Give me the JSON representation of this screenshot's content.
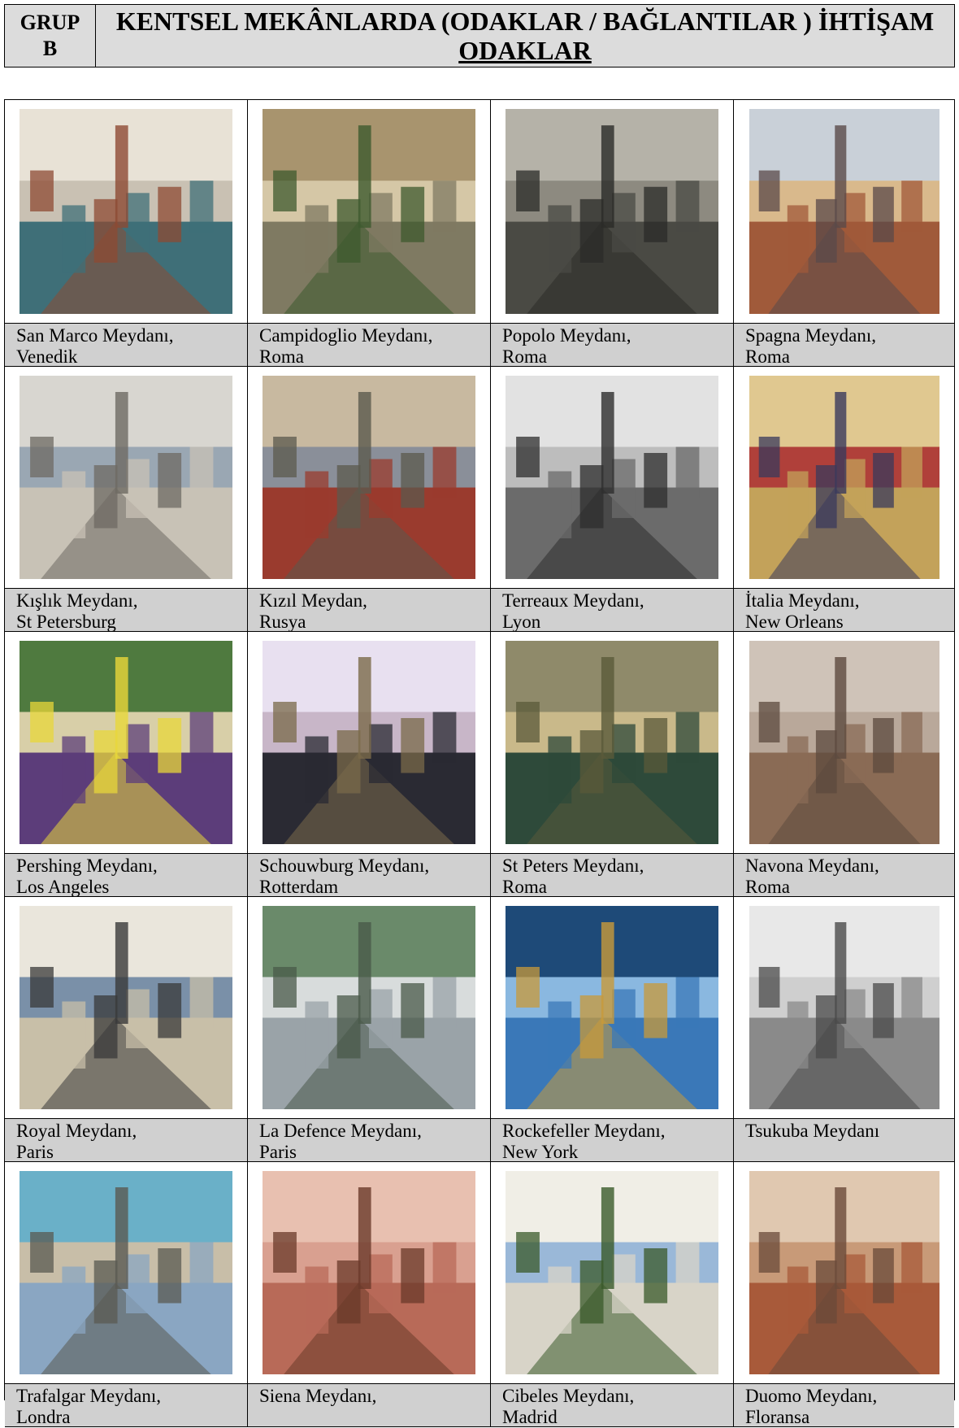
{
  "header": {
    "grup_label": "GRUP",
    "grup_value": "B",
    "title": "KENTSEL MEKÂNLARDA (ODAKLAR / BAĞLANTILAR ) İHTİŞAM",
    "subtitle": "ODAKLAR"
  },
  "cells": [
    {
      "line1": "San Marco Meydanı,",
      "line2": "Venedik",
      "palette": [
        "#3f6f78",
        "#c9c1b3",
        "#8d4a33",
        "#e8e2d6"
      ]
    },
    {
      "line1": "Campidoglio Meydanı,",
      "line2": "Roma",
      "palette": [
        "#7f7a62",
        "#d5c7a6",
        "#3d5a2e",
        "#a8946e"
      ]
    },
    {
      "line1": "Popolo Meydanı,",
      "line2": "Roma",
      "palette": [
        "#4a4a44",
        "#8d8a80",
        "#2b2b28",
        "#b5b2a8"
      ]
    },
    {
      "line1": "Spagna Meydanı,",
      "line2": "Roma",
      "palette": [
        "#a05a3a",
        "#d9b98c",
        "#5a4a4a",
        "#c9d0d8"
      ]
    },
    {
      "line1": "Kışlık Meydanı,",
      "line2": "St Petersburg",
      "palette": [
        "#c8c2b6",
        "#9aa7b3",
        "#6e6a63",
        "#d8d6d0"
      ]
    },
    {
      "line1": "Kızıl Meydan,",
      "line2": "Rusya",
      "palette": [
        "#9a3b2e",
        "#8a8f99",
        "#5b5a4e",
        "#c8b9a0"
      ]
    },
    {
      "line1": "Terreaux Meydanı,",
      "line2": "Lyon",
      "palette": [
        "#6b6b6b",
        "#bdbdbd",
        "#2e2e2e",
        "#e2e2e2"
      ]
    },
    {
      "line1": "İtalia Meydanı,",
      "line2": "New Orleans",
      "palette": [
        "#c3a25a",
        "#b0403a",
        "#3a3a5c",
        "#e0c890"
      ]
    },
    {
      "line1": "Pershing Meydanı,",
      "line2": "Los Angeles",
      "palette": [
        "#5c3d7a",
        "#d8cfa8",
        "#e8d73a",
        "#4f7a3f"
      ]
    },
    {
      "line1": "Schouwburg Meydanı,",
      "line2": "Rotterdam",
      "palette": [
        "#2a2a33",
        "#c8b6c8",
        "#7a6a4a",
        "#e8e0f0"
      ]
    },
    {
      "line1": "St Peters Meydanı,",
      "line2": "Roma",
      "palette": [
        "#2e4a3a",
        "#c9b98a",
        "#5a5a3a",
        "#8f8a6a"
      ]
    },
    {
      "line1": "Navona Meydanı,",
      "line2": "Roma",
      "palette": [
        "#8a6b55",
        "#b9a89a",
        "#5c4a3e",
        "#cfc3b8"
      ]
    },
    {
      "line1": "Royal Meydanı,",
      "line2": "Paris",
      "palette": [
        "#c8bfa8",
        "#7a90a8",
        "#3a3a3a",
        "#eae6dc"
      ]
    },
    {
      "line1": "La Defence Meydanı,",
      "line2": "Paris",
      "palette": [
        "#9aa3a8",
        "#d8dcdc",
        "#4a5a4a",
        "#6a8a6a"
      ]
    },
    {
      "line1": "Rockefeller Meydanı,",
      "line2": "New York",
      "palette": [
        "#3a78b8",
        "#8ab8e0",
        "#c89a3a",
        "#1e4a78"
      ]
    },
    {
      "line1": "Tsukuba Meydanı",
      "line2": "",
      "palette": [
        "#8a8a8a",
        "#cfcfcf",
        "#4a4a4a",
        "#e8e8e8"
      ]
    },
    {
      "line1": "Trafalgar Meydanı,",
      "line2": "Londra",
      "palette": [
        "#8aa6c2",
        "#c8bea8",
        "#5a5a52",
        "#6ab0c8"
      ]
    },
    {
      "line1": "Siena Meydanı,",
      "line2": "",
      "palette": [
        "#b86a58",
        "#d9a090",
        "#6a3a2a",
        "#e8c0b0"
      ]
    },
    {
      "line1": "Cibeles Meydanı,",
      "line2": "Madrid",
      "palette": [
        "#d8d4c8",
        "#9ab8d8",
        "#3a5a2a",
        "#f0eee6"
      ]
    },
    {
      "line1": "Duomo Meydanı,",
      "line2": "Floransa",
      "palette": [
        "#a85a3a",
        "#c89a78",
        "#6a4a3a",
        "#e0c8b0"
      ]
    }
  ]
}
